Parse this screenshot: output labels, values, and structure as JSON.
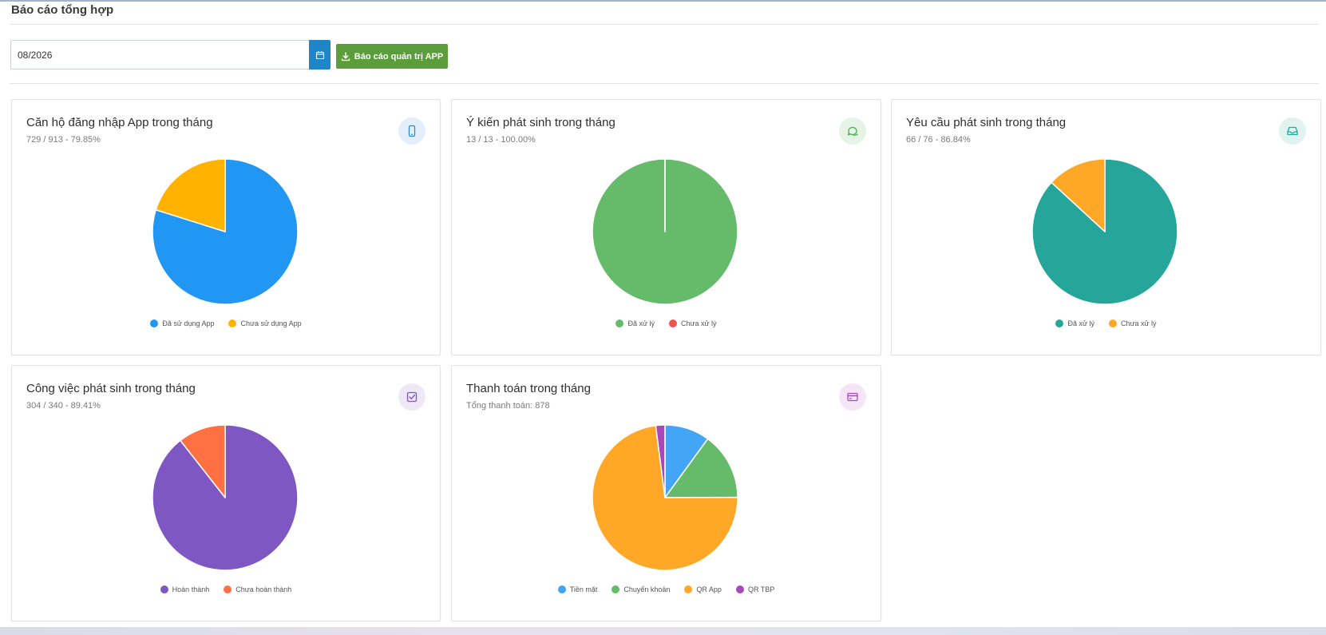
{
  "page": {
    "title": "Báo cáo tổng hợp",
    "month_value": "08/2026",
    "export_label": "Báo cáo quản trị APP"
  },
  "colors": {
    "blue": "#2196f3",
    "amber": "#ffb300",
    "green": "#66bb6a",
    "red": "#ef5350",
    "teal": "#26a69a",
    "orange": "#ffa726",
    "purple": "#7e57c2",
    "coral": "#ff7043",
    "violet": "#ab47bc",
    "button_green": "#5b9d3a",
    "calendar_blue": "#1e86c8"
  },
  "cards": [
    {
      "title": "Căn hộ đăng nhập App trong tháng",
      "subtitle": "729 / 913 - 79.85%",
      "icon": "smartphone-icon",
      "icon_bg": "#e3f0fb",
      "icon_color": "#2f87cf"
    },
    {
      "title": "Ý kiến phát sinh trong tháng",
      "subtitle": "13 / 13 - 100.00%",
      "icon": "chat-icon",
      "icon_bg": "#e6f4e7",
      "icon_color": "#4caf50"
    },
    {
      "title": "Yêu cầu phát sinh trong tháng",
      "subtitle": "66 / 76 - 86.84%",
      "icon": "inbox-icon",
      "icon_bg": "#e0f3f1",
      "icon_color": "#26a69a"
    },
    {
      "title": "Công việc phát sinh trong tháng",
      "subtitle": "304 / 340 - 89.41%",
      "icon": "checkbox-icon",
      "icon_bg": "#efe9f7",
      "icon_color": "#7e57c2"
    },
    {
      "title": "Thanh toán trong tháng",
      "subtitle": "Tổng thanh toán: 878",
      "icon": "credit-card-icon",
      "icon_bg": "#f5e6f7",
      "icon_color": "#ab47bc"
    }
  ],
  "chart_data": [
    {
      "type": "pie",
      "categories": [
        "Đã sử dụng App",
        "Chưa sử dụng App"
      ],
      "values": [
        729,
        184
      ],
      "colors": [
        "#2196f3",
        "#ffb300"
      ],
      "legend": "bottom"
    },
    {
      "type": "pie",
      "categories": [
        "Đã xử lý",
        "Chưa xử lý"
      ],
      "values": [
        13,
        0
      ],
      "colors": [
        "#66bb6a",
        "#ef5350"
      ],
      "legend": "bottom"
    },
    {
      "type": "pie",
      "categories": [
        "Đã xử lý",
        "Chưa xử lý"
      ],
      "values": [
        66,
        10
      ],
      "colors": [
        "#26a69a",
        "#ffa726"
      ],
      "legend": "bottom"
    },
    {
      "type": "pie",
      "categories": [
        "Hoàn thành",
        "Chưa hoàn thành"
      ],
      "values": [
        304,
        36
      ],
      "colors": [
        "#7e57c2",
        "#ff7043"
      ],
      "legend": "bottom"
    },
    {
      "type": "pie",
      "categories": [
        "Tiền mặt",
        "Chuyển khoản",
        "QR App",
        "QR TBP"
      ],
      "values": [
        88,
        131,
        641,
        18
      ],
      "colors": [
        "#42a5f5",
        "#66bb6a",
        "#ffa726",
        "#ab47bc"
      ],
      "legend": "bottom"
    }
  ]
}
